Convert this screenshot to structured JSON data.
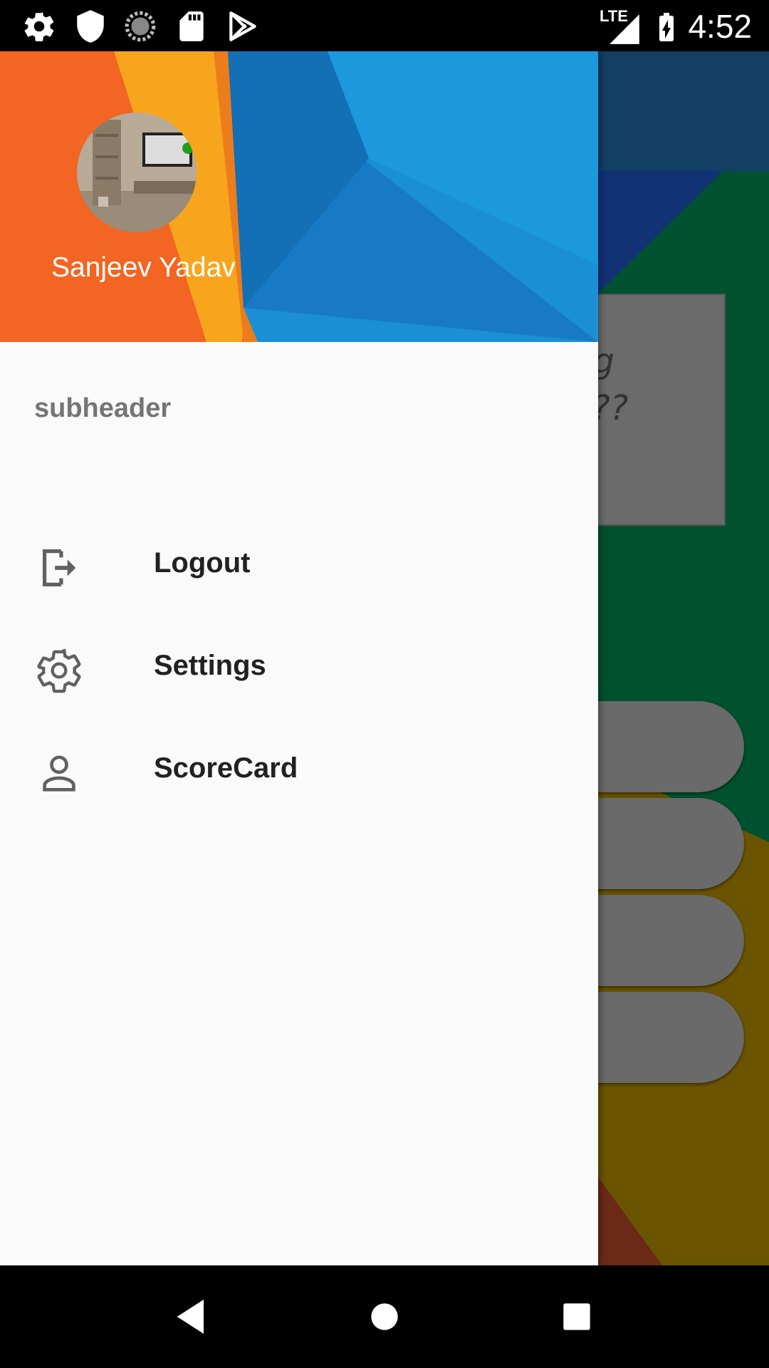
{
  "status_bar": {
    "time": "4:52",
    "network_label": "LTE",
    "icons": [
      "settings-icon",
      "shield-icon",
      "sync-icon",
      "sd-card-icon",
      "play-store-icon",
      "signal-icon",
      "battery-charging-icon"
    ]
  },
  "background_app": {
    "card_text_line1": "ng",
    "card_text_line2": "a??",
    "colors": {
      "toolbar": "#123f63",
      "green": "#00512f",
      "yellow": "#6b5400"
    }
  },
  "drawer": {
    "header": {
      "user_name": "Sanjeev Yadav",
      "colors": {
        "orange": "#f26522",
        "amber": "#f8a51e",
        "blue": "#1a8fd6"
      }
    },
    "subheader": "subheader",
    "items": [
      {
        "label": "Logout",
        "icon": "logout-icon"
      },
      {
        "label": "Settings",
        "icon": "gear-icon"
      },
      {
        "label": "ScoreCard",
        "icon": "person-icon"
      }
    ]
  },
  "nav_bar": {
    "buttons": [
      "back-icon",
      "home-icon",
      "recents-icon"
    ]
  }
}
